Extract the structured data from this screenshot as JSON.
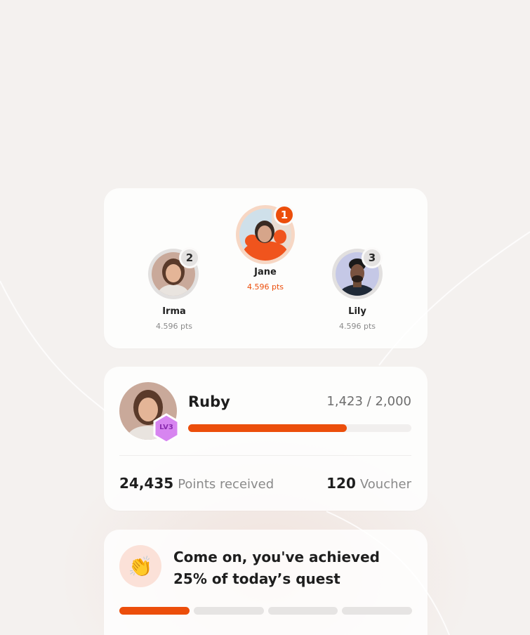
{
  "leaderboard": {
    "players": [
      {
        "rank": "1",
        "name": "Jane",
        "points": "4.596 pts",
        "avatar": "woman-orange-sweater-avatar"
      },
      {
        "rank": "2",
        "name": "Irma",
        "points": "4.596 pts",
        "avatar": "woman-smiling-avatar"
      },
      {
        "rank": "3",
        "name": "Lily",
        "points": "4.596 pts",
        "avatar": "man-jacket-avatar"
      }
    ]
  },
  "profile": {
    "name": "Ruby",
    "level_badge": "LV3",
    "progress_text": "1,423 / 2,000",
    "progress_fraction": 0.7115,
    "points_value": "24,435",
    "points_label": "Points received",
    "voucher_value": "120",
    "voucher_label": "Voucher"
  },
  "quest": {
    "emoji": "👏",
    "message": "Come on, you've achieved 25% of today’s quest",
    "segments_total": 4,
    "segments_done": 1
  },
  "colors": {
    "accent": "#ec4e0b",
    "rank1": "#ec4e0b",
    "rank_other": "#e4e2e1",
    "level_badge": "#d785f0"
  }
}
